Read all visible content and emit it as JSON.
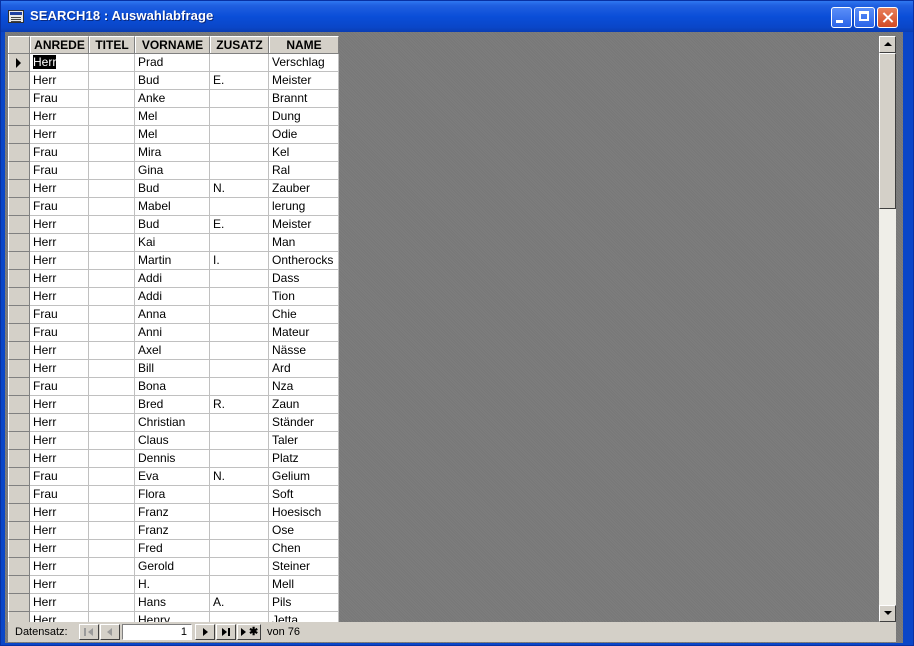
{
  "window": {
    "title": "SEARCH18 : Auswahlabfrage"
  },
  "grid": {
    "columns": [
      "ANREDE",
      "TITEL",
      "VORNAME",
      "ZUSATZ",
      "NAME"
    ],
    "rows": [
      [
        "Herr",
        "",
        "Prad",
        "",
        "Verschlag"
      ],
      [
        "Herr",
        "",
        "Bud",
        "E.",
        "Meister"
      ],
      [
        "Frau",
        "",
        "Anke",
        "",
        "Brannt"
      ],
      [
        "Herr",
        "",
        "Mel",
        "",
        "Dung"
      ],
      [
        "Herr",
        "",
        "Mel",
        "",
        "Odie"
      ],
      [
        "Frau",
        "",
        "Mira",
        "",
        "Kel"
      ],
      [
        "Frau",
        "",
        "Gina",
        "",
        "Ral"
      ],
      [
        "Herr",
        "",
        "Bud",
        "N.",
        "Zauber"
      ],
      [
        "Frau",
        "",
        "Mabel",
        "",
        "lerung"
      ],
      [
        "Herr",
        "",
        "Bud",
        "E.",
        "Meister"
      ],
      [
        "Herr",
        "",
        "Kai",
        "",
        "Man"
      ],
      [
        "Herr",
        "",
        "Martin",
        "I.",
        "Ontherocks"
      ],
      [
        "Herr",
        "",
        "Addi",
        "",
        "Dass"
      ],
      [
        "Herr",
        "",
        "Addi",
        "",
        "Tion"
      ],
      [
        "Frau",
        "",
        "Anna",
        "",
        "Chie"
      ],
      [
        "Frau",
        "",
        "Anni",
        "",
        "Mateur"
      ],
      [
        "Herr",
        "",
        "Axel",
        "",
        "Nässe"
      ],
      [
        "Herr",
        "",
        "Bill",
        "",
        "Ard"
      ],
      [
        "Frau",
        "",
        "Bona",
        "",
        "Nza"
      ],
      [
        "Herr",
        "",
        "Bred",
        "R.",
        "Zaun"
      ],
      [
        "Herr",
        "",
        "Christian",
        "",
        "Ständer"
      ],
      [
        "Herr",
        "",
        "Claus",
        "",
        "Taler"
      ],
      [
        "Herr",
        "",
        "Dennis",
        "",
        "Platz"
      ],
      [
        "Frau",
        "",
        "Eva",
        "N.",
        "Gelium"
      ],
      [
        "Frau",
        "",
        "Flora",
        "",
        "Soft"
      ],
      [
        "Herr",
        "",
        "Franz",
        "",
        "Hoesisch"
      ],
      [
        "Herr",
        "",
        "Franz",
        "",
        "Ose"
      ],
      [
        "Herr",
        "",
        "Fred",
        "",
        "Chen"
      ],
      [
        "Herr",
        "",
        "Gerold",
        "",
        "Steiner"
      ],
      [
        "Herr",
        "",
        "H.",
        "",
        "Mell"
      ],
      [
        "Herr",
        "",
        "Hans",
        "A.",
        "Pils"
      ],
      [
        "Herr",
        "",
        "Henry",
        "",
        "Jetta"
      ]
    ],
    "current_row": 0
  },
  "navigation": {
    "label": "Datensatz:",
    "current_record": "1",
    "of_label": "von",
    "total": "76"
  },
  "icons": [
    "app-icon",
    "minimize-icon",
    "maximize-icon",
    "close-icon",
    "first-record-icon",
    "previous-record-icon",
    "next-record-icon",
    "last-record-icon",
    "new-record-icon",
    "scroll-up-icon",
    "scroll-down-icon"
  ]
}
